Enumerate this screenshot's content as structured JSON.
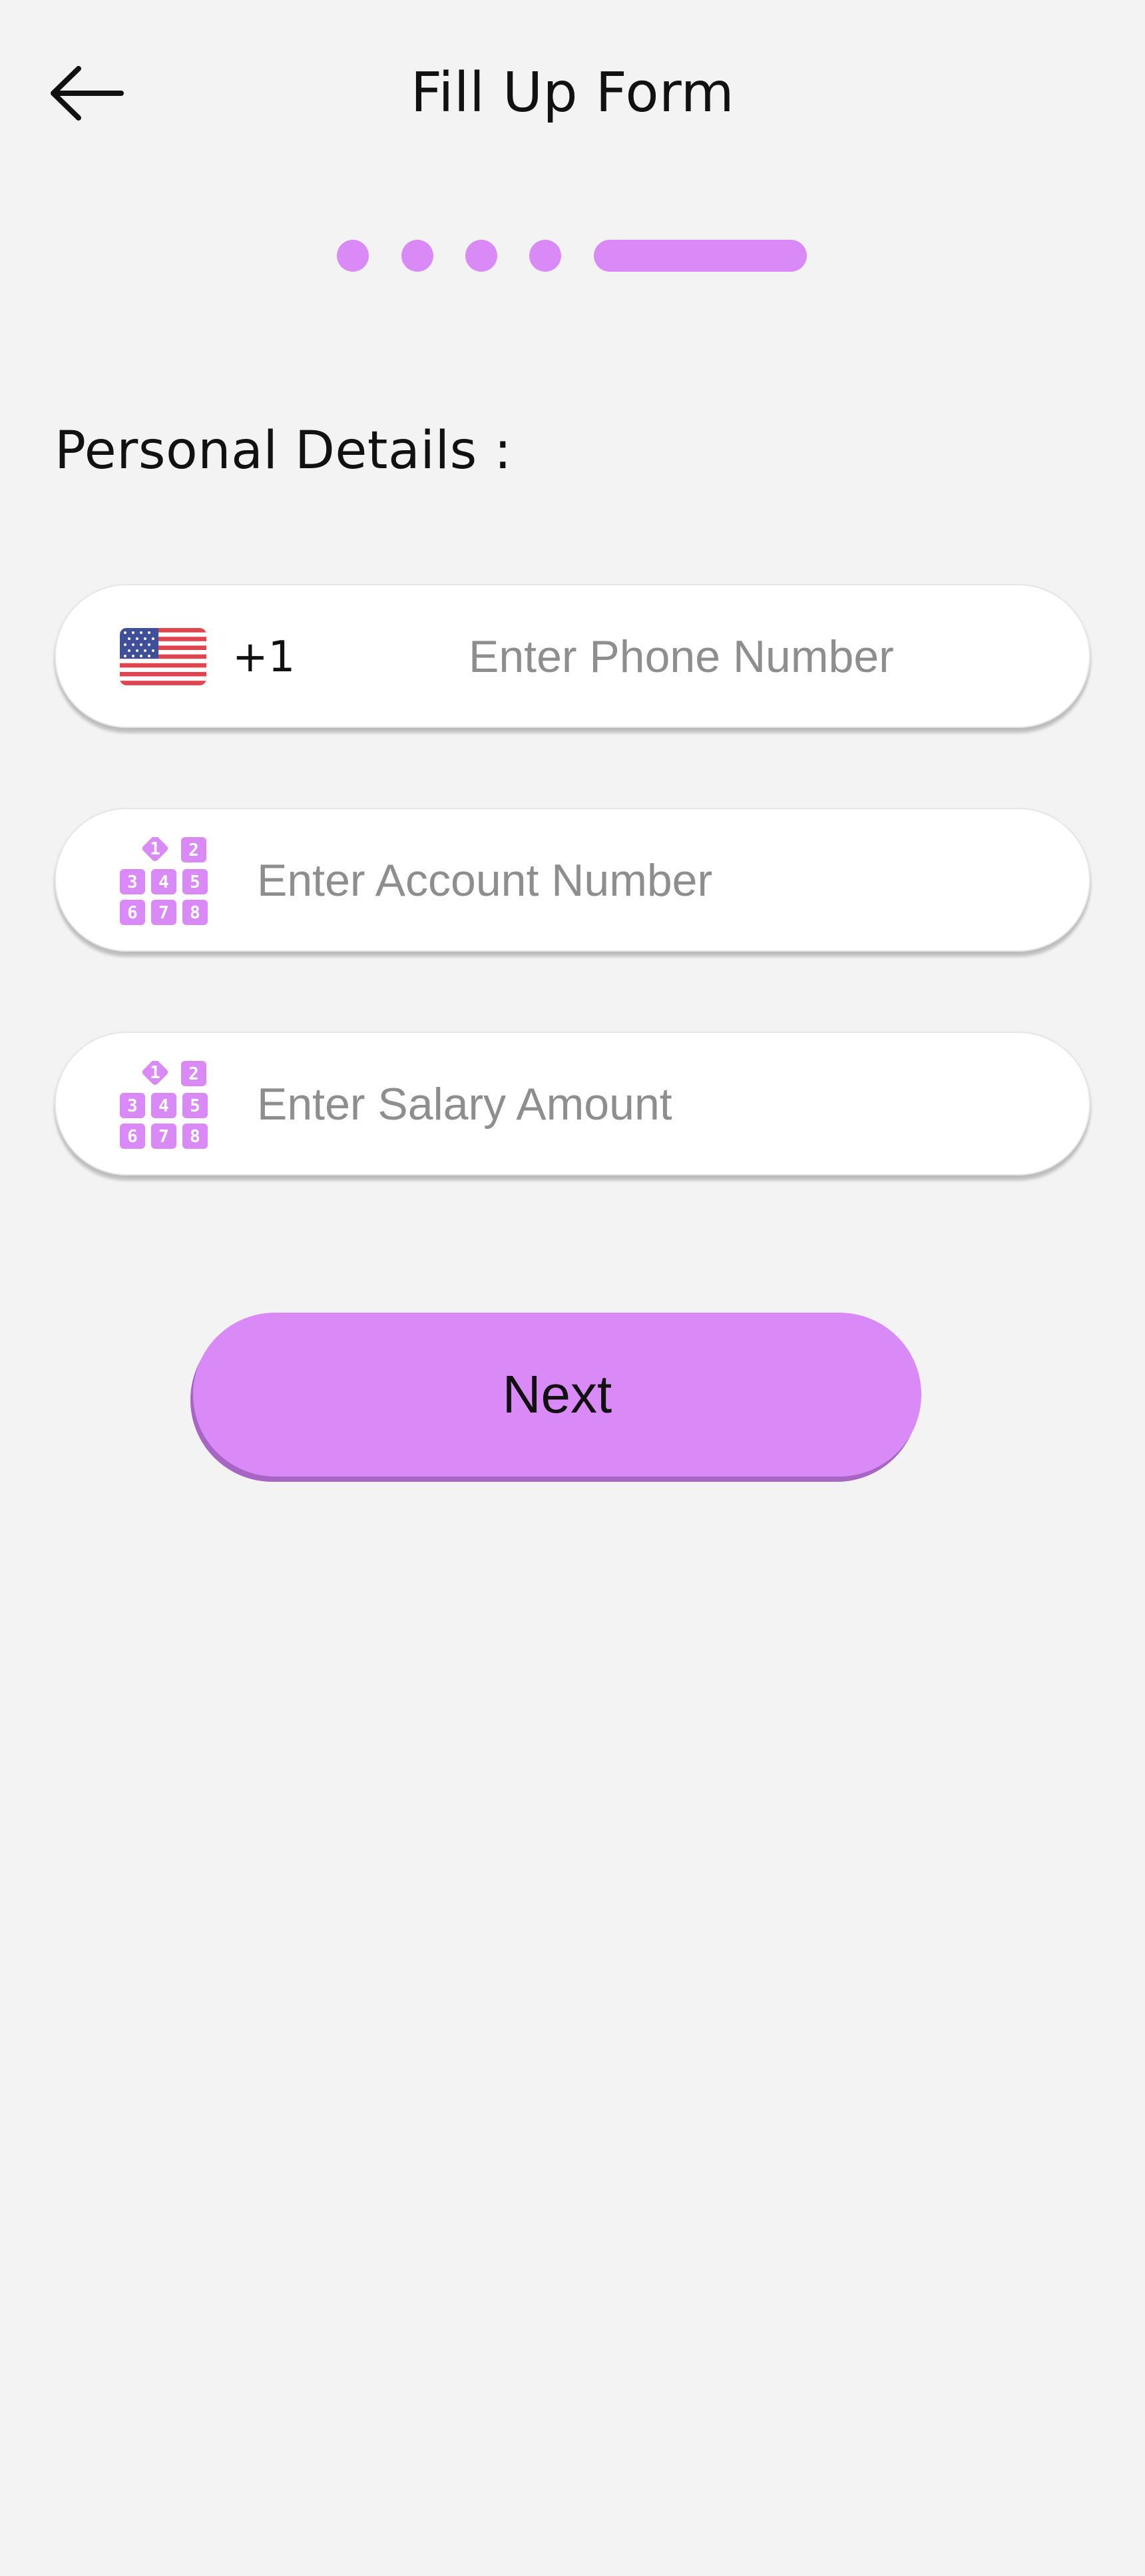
{
  "header": {
    "title": "Fill Up Form",
    "back_icon": "arrow-left-icon"
  },
  "stepper": {
    "total_steps": 5,
    "current_step": 5
  },
  "section": {
    "title": "Personal Details :"
  },
  "form": {
    "phone": {
      "country_flag": "us-flag-icon",
      "country_code": "+1",
      "placeholder": "Enter Phone Number",
      "value": ""
    },
    "account": {
      "icon": "keypad-icon",
      "placeholder": "Enter Account Number",
      "value": ""
    },
    "salary": {
      "icon": "keypad-icon",
      "placeholder": "Enter Salary Amount",
      "value": ""
    }
  },
  "actions": {
    "next_label": "Next"
  },
  "colors": {
    "accent": "#d98af7",
    "accent_shadow": "#a765c4",
    "background": "#f3f3f3",
    "placeholder": "#8e8e8e"
  }
}
